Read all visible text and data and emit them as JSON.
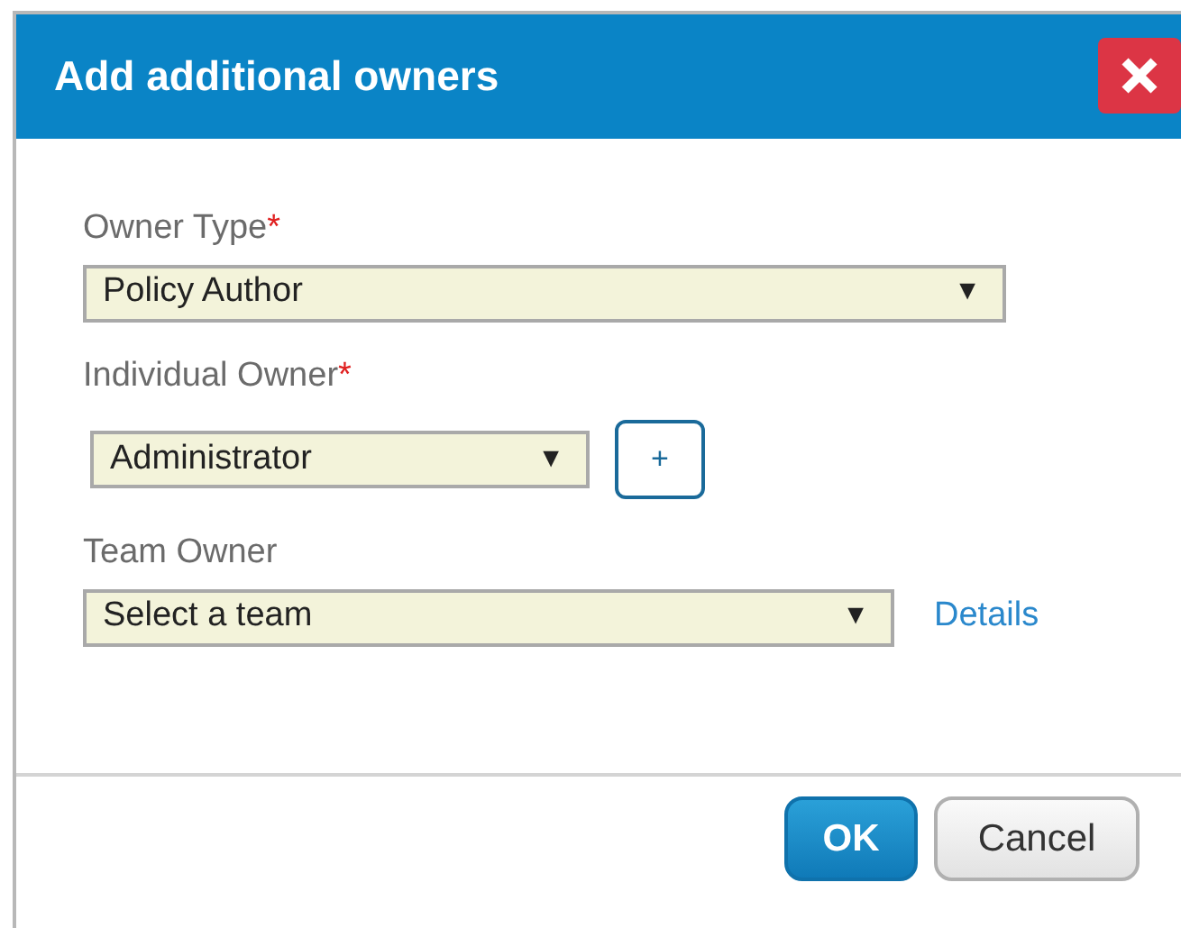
{
  "dialog": {
    "title": "Add additional owners"
  },
  "fields": [
    {
      "label": "Owner Type",
      "required_mark": "*",
      "value": "Policy Author",
      "arrow": "▼"
    },
    {
      "label": "Individual Owner",
      "required_mark": "*",
      "value": "Administrator",
      "arrow": "▼",
      "extra": {
        "kind": "button",
        "text": "+"
      }
    },
    {
      "label": "Team Owner",
      "value": "Select a team",
      "arrow": "▼",
      "extra": {
        "kind": "link",
        "text": "Details"
      }
    }
  ],
  "buttons": [
    {
      "label": "OK",
      "kind": "primary"
    },
    {
      "label": "Cancel",
      "kind": "secondary"
    }
  ]
}
